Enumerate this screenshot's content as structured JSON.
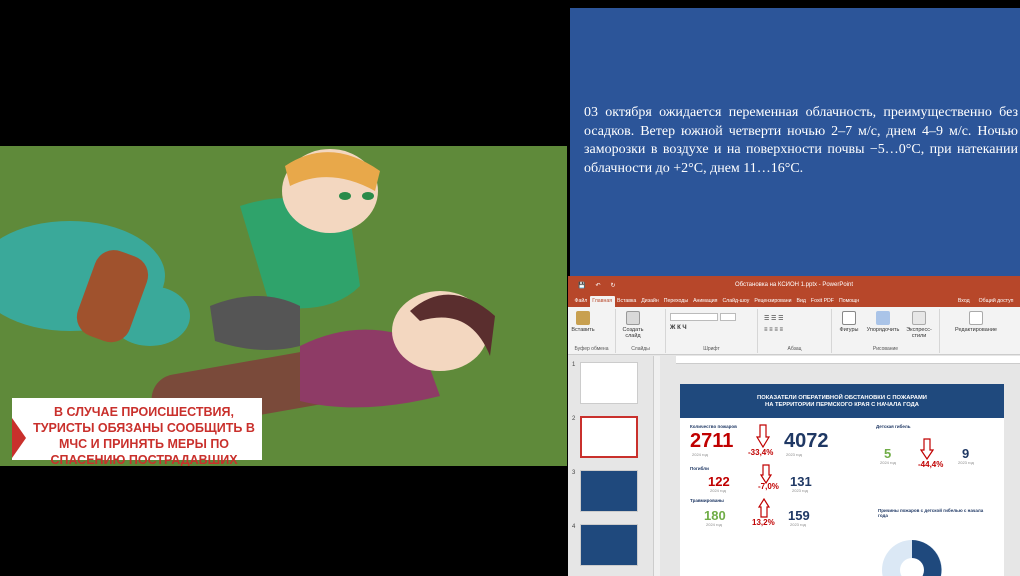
{
  "video": {
    "caption": "В случае происшествия, туристы обязаны сообщить в МЧС и принять меры по спасению пострадавших"
  },
  "weather": {
    "text": "03 октября ожидается переменная облачность, преимущественно без осадков. Ветер южной четверти ночью 2–7 м/с, днем 4–9 м/с. Ночью заморозки в воздухе и на поверхности почвы −5…0°С, при натекании облачности до +2°С, днем 11…16°С."
  },
  "ppt": {
    "title": "Обстановка на КСИОН 1.pptx - PowerPoint",
    "tabs": [
      "Файл",
      "Главная",
      "Вставка",
      "Дизайн",
      "Переходы",
      "Анимация",
      "Слайд-шоу",
      "Рецензировани",
      "Вид",
      "Foxit PDF",
      "Помощн",
      "Вход",
      "Общий доступ"
    ],
    "ribbon": {
      "paste": "Вставить",
      "new_slide": "Создать слайд",
      "shapes": "Фигуры",
      "arrange": "Упорядочить",
      "quick_styles": "Экспресс-стили",
      "editing": "Редактирование",
      "groups": [
        "Буфер обмена",
        "Слайды",
        "Шрифт",
        "Абзац",
        "Рисование"
      ]
    },
    "thumb_numbers": [
      "1",
      "2",
      "3",
      "4"
    ],
    "slide": {
      "header_line1": "ПОКАЗАТЕЛИ ОПЕРАТИВНОЙ ОБСТАНОВКИ С ПОЖАРАМИ",
      "header_line2": "НА ТЕРРИТОРИИ ПЕРМСКОГО КРАЯ С НАЧАЛА ГОДА",
      "fires_label": "Количество пожаров",
      "fires_2024": "2711",
      "fires_pct": "-33,4%",
      "fires_2023": "4072",
      "deaths_label": "Погибли",
      "deaths_2024": "122",
      "deaths_pct": "-7,0%",
      "deaths_2023": "131",
      "injured_label": "Травмированы",
      "injured_2024": "180",
      "injured_pct": "13,2%",
      "injured_2023": "159",
      "child_label": "Детская гибель",
      "child_2024": "5",
      "child_pct": "-44,4%",
      "child_2023": "9",
      "causes_label": "Причины пожаров с детской гибелью с начала года",
      "year_a": "2024 год",
      "year_b": "2023 год"
    }
  },
  "colors": {
    "accent_red": "#c00000",
    "navy": "#1f497d",
    "ppt_red": "#b7472a",
    "weather_bg": "#2c5599"
  }
}
